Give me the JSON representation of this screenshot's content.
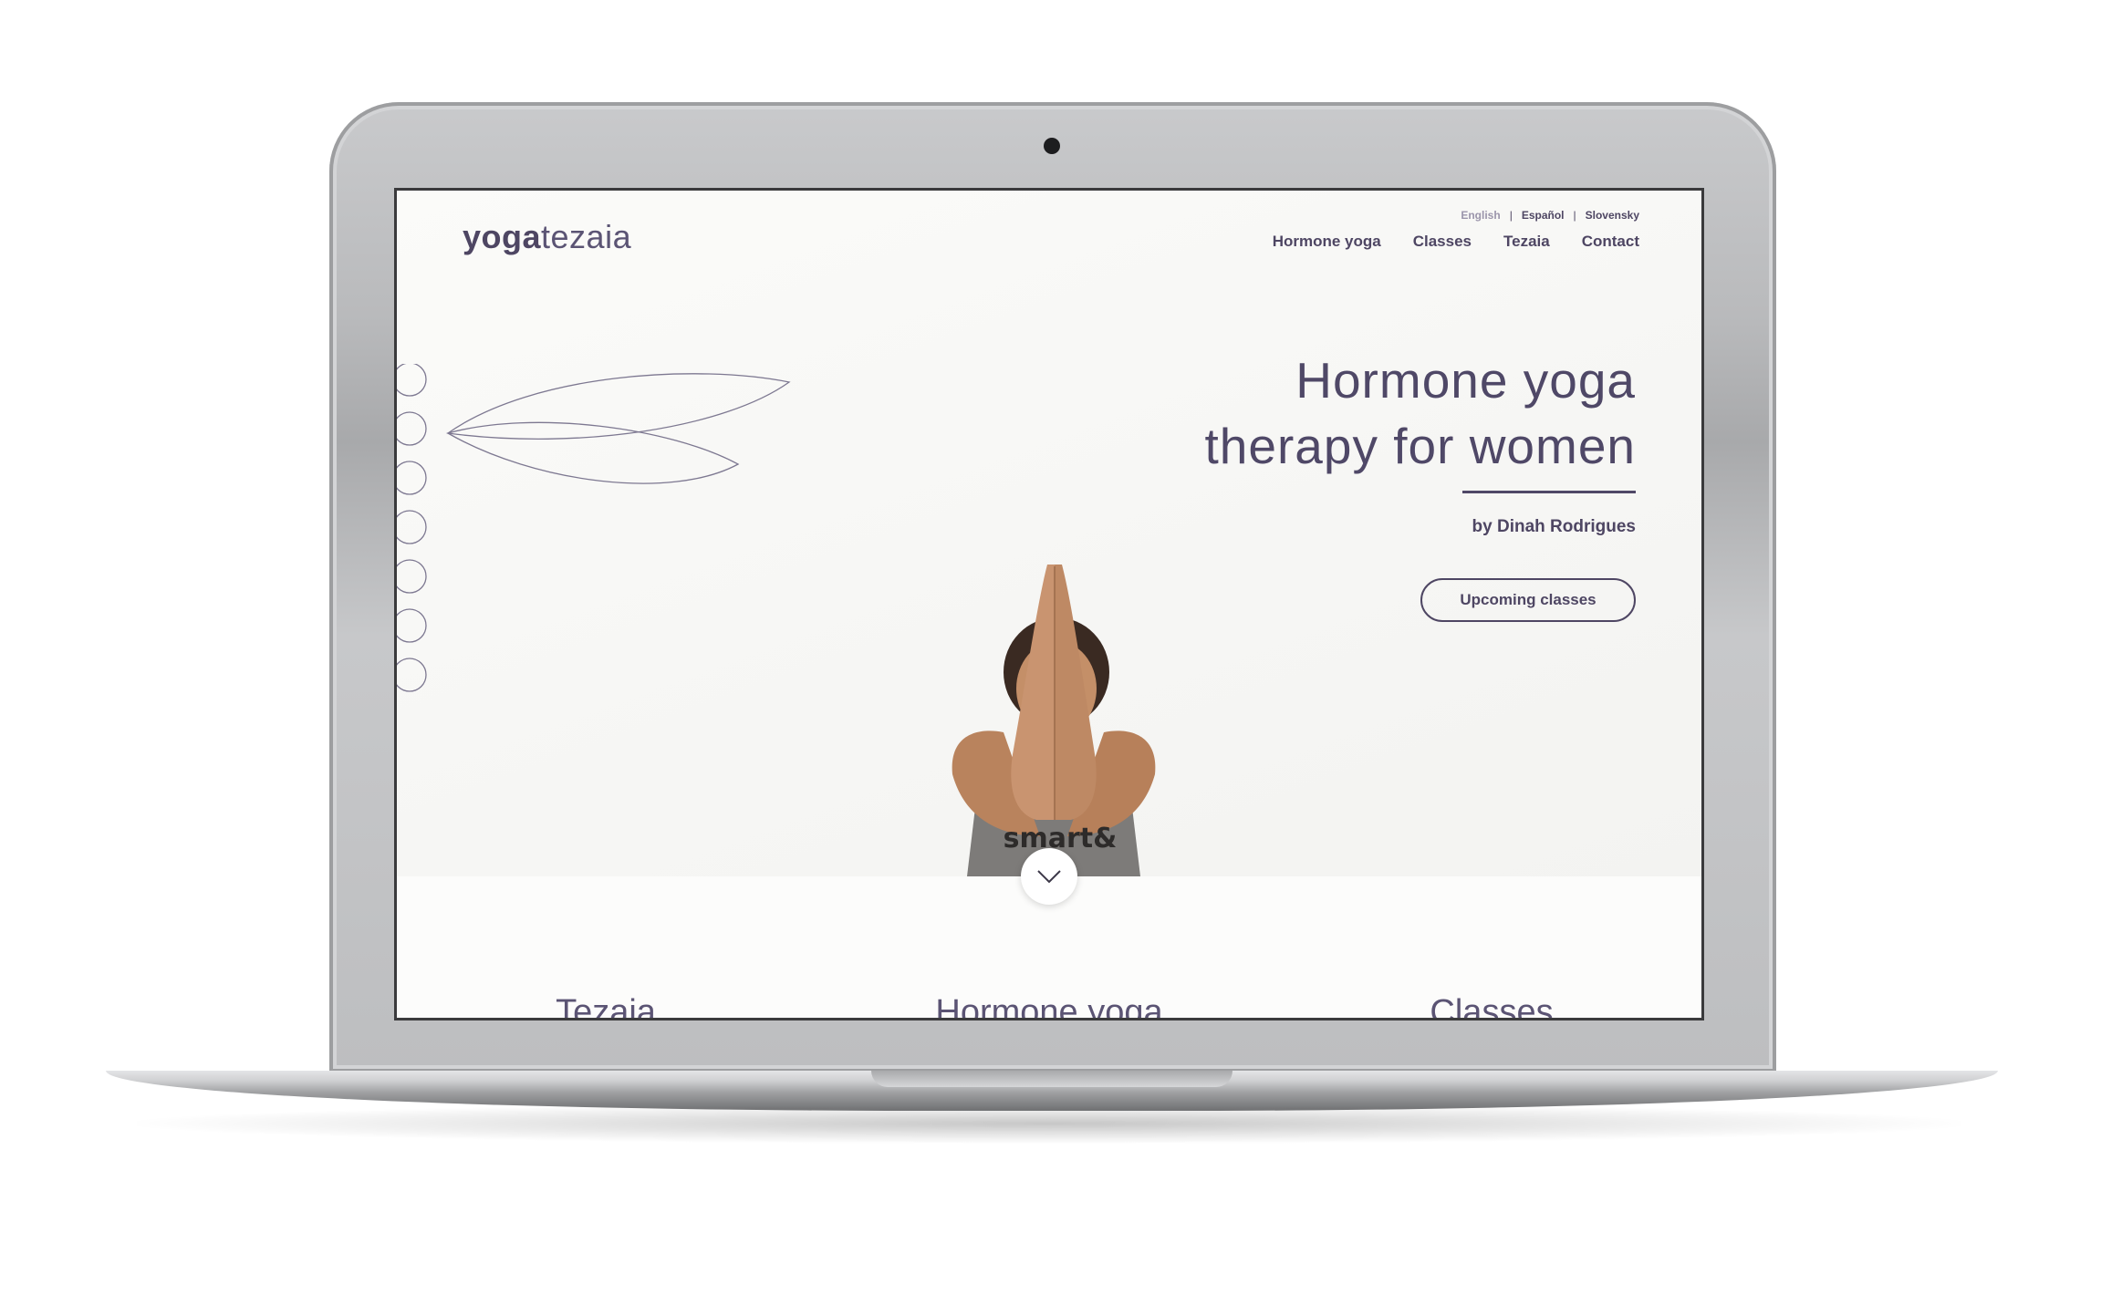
{
  "header": {
    "logo": {
      "bold": "yoga",
      "light": "tezaia"
    },
    "languages": [
      "English",
      "Español",
      "Slovensky"
    ],
    "language_separator": "|",
    "nav": [
      "Hormone yoga",
      "Classes",
      "Tezaia",
      "Contact"
    ]
  },
  "hero": {
    "title_line1": "Hormone yoga",
    "title_line2": "therapy for women",
    "byline": "by Dinah Rodrigues",
    "cta_label": "Upcoming classes",
    "shirt_text": "smart&"
  },
  "sections": {
    "titles": [
      "Tezaia",
      "Hormone yoga",
      "Classes"
    ]
  },
  "icons": {
    "scroll": "chevron-down-icon",
    "decor": "lotus-petals-icon"
  },
  "colors": {
    "brand": "#4e4663",
    "background": "#fcfcfb"
  }
}
